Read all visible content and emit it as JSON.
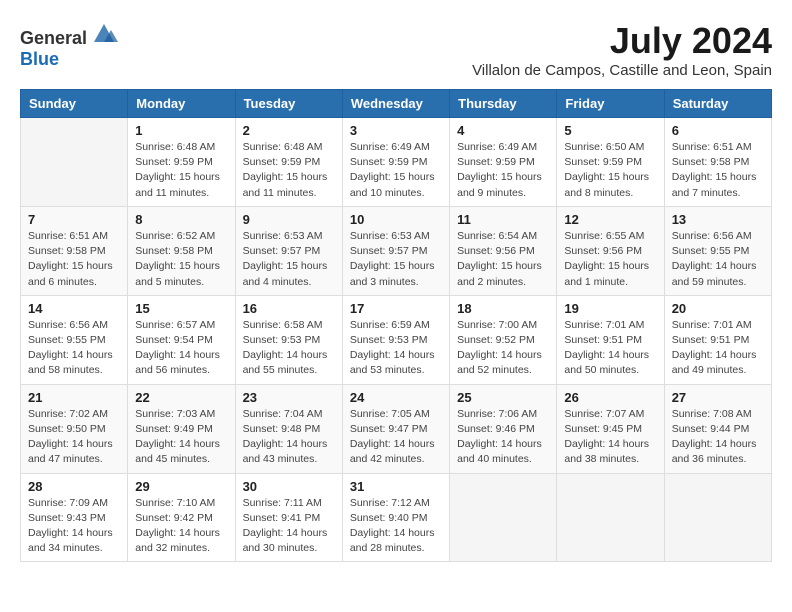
{
  "header": {
    "logo_general": "General",
    "logo_blue": "Blue",
    "month_year": "July 2024",
    "location": "Villalon de Campos, Castille and Leon, Spain"
  },
  "weekdays": [
    "Sunday",
    "Monday",
    "Tuesday",
    "Wednesday",
    "Thursday",
    "Friday",
    "Saturday"
  ],
  "weeks": [
    [
      {
        "day": "",
        "sunrise": "",
        "sunset": "",
        "daylight": ""
      },
      {
        "day": "1",
        "sunrise": "Sunrise: 6:48 AM",
        "sunset": "Sunset: 9:59 PM",
        "daylight": "Daylight: 15 hours and 11 minutes."
      },
      {
        "day": "2",
        "sunrise": "Sunrise: 6:48 AM",
        "sunset": "Sunset: 9:59 PM",
        "daylight": "Daylight: 15 hours and 11 minutes."
      },
      {
        "day": "3",
        "sunrise": "Sunrise: 6:49 AM",
        "sunset": "Sunset: 9:59 PM",
        "daylight": "Daylight: 15 hours and 10 minutes."
      },
      {
        "day": "4",
        "sunrise": "Sunrise: 6:49 AM",
        "sunset": "Sunset: 9:59 PM",
        "daylight": "Daylight: 15 hours and 9 minutes."
      },
      {
        "day": "5",
        "sunrise": "Sunrise: 6:50 AM",
        "sunset": "Sunset: 9:59 PM",
        "daylight": "Daylight: 15 hours and 8 minutes."
      },
      {
        "day": "6",
        "sunrise": "Sunrise: 6:51 AM",
        "sunset": "Sunset: 9:58 PM",
        "daylight": "Daylight: 15 hours and 7 minutes."
      }
    ],
    [
      {
        "day": "7",
        "sunrise": "Sunrise: 6:51 AM",
        "sunset": "Sunset: 9:58 PM",
        "daylight": "Daylight: 15 hours and 6 minutes."
      },
      {
        "day": "8",
        "sunrise": "Sunrise: 6:52 AM",
        "sunset": "Sunset: 9:58 PM",
        "daylight": "Daylight: 15 hours and 5 minutes."
      },
      {
        "day": "9",
        "sunrise": "Sunrise: 6:53 AM",
        "sunset": "Sunset: 9:57 PM",
        "daylight": "Daylight: 15 hours and 4 minutes."
      },
      {
        "day": "10",
        "sunrise": "Sunrise: 6:53 AM",
        "sunset": "Sunset: 9:57 PM",
        "daylight": "Daylight: 15 hours and 3 minutes."
      },
      {
        "day": "11",
        "sunrise": "Sunrise: 6:54 AM",
        "sunset": "Sunset: 9:56 PM",
        "daylight": "Daylight: 15 hours and 2 minutes."
      },
      {
        "day": "12",
        "sunrise": "Sunrise: 6:55 AM",
        "sunset": "Sunset: 9:56 PM",
        "daylight": "Daylight: 15 hours and 1 minute."
      },
      {
        "day": "13",
        "sunrise": "Sunrise: 6:56 AM",
        "sunset": "Sunset: 9:55 PM",
        "daylight": "Daylight: 14 hours and 59 minutes."
      }
    ],
    [
      {
        "day": "14",
        "sunrise": "Sunrise: 6:56 AM",
        "sunset": "Sunset: 9:55 PM",
        "daylight": "Daylight: 14 hours and 58 minutes."
      },
      {
        "day": "15",
        "sunrise": "Sunrise: 6:57 AM",
        "sunset": "Sunset: 9:54 PM",
        "daylight": "Daylight: 14 hours and 56 minutes."
      },
      {
        "day": "16",
        "sunrise": "Sunrise: 6:58 AM",
        "sunset": "Sunset: 9:53 PM",
        "daylight": "Daylight: 14 hours and 55 minutes."
      },
      {
        "day": "17",
        "sunrise": "Sunrise: 6:59 AM",
        "sunset": "Sunset: 9:53 PM",
        "daylight": "Daylight: 14 hours and 53 minutes."
      },
      {
        "day": "18",
        "sunrise": "Sunrise: 7:00 AM",
        "sunset": "Sunset: 9:52 PM",
        "daylight": "Daylight: 14 hours and 52 minutes."
      },
      {
        "day": "19",
        "sunrise": "Sunrise: 7:01 AM",
        "sunset": "Sunset: 9:51 PM",
        "daylight": "Daylight: 14 hours and 50 minutes."
      },
      {
        "day": "20",
        "sunrise": "Sunrise: 7:01 AM",
        "sunset": "Sunset: 9:51 PM",
        "daylight": "Daylight: 14 hours and 49 minutes."
      }
    ],
    [
      {
        "day": "21",
        "sunrise": "Sunrise: 7:02 AM",
        "sunset": "Sunset: 9:50 PM",
        "daylight": "Daylight: 14 hours and 47 minutes."
      },
      {
        "day": "22",
        "sunrise": "Sunrise: 7:03 AM",
        "sunset": "Sunset: 9:49 PM",
        "daylight": "Daylight: 14 hours and 45 minutes."
      },
      {
        "day": "23",
        "sunrise": "Sunrise: 7:04 AM",
        "sunset": "Sunset: 9:48 PM",
        "daylight": "Daylight: 14 hours and 43 minutes."
      },
      {
        "day": "24",
        "sunrise": "Sunrise: 7:05 AM",
        "sunset": "Sunset: 9:47 PM",
        "daylight": "Daylight: 14 hours and 42 minutes."
      },
      {
        "day": "25",
        "sunrise": "Sunrise: 7:06 AM",
        "sunset": "Sunset: 9:46 PM",
        "daylight": "Daylight: 14 hours and 40 minutes."
      },
      {
        "day": "26",
        "sunrise": "Sunrise: 7:07 AM",
        "sunset": "Sunset: 9:45 PM",
        "daylight": "Daylight: 14 hours and 38 minutes."
      },
      {
        "day": "27",
        "sunrise": "Sunrise: 7:08 AM",
        "sunset": "Sunset: 9:44 PM",
        "daylight": "Daylight: 14 hours and 36 minutes."
      }
    ],
    [
      {
        "day": "28",
        "sunrise": "Sunrise: 7:09 AM",
        "sunset": "Sunset: 9:43 PM",
        "daylight": "Daylight: 14 hours and 34 minutes."
      },
      {
        "day": "29",
        "sunrise": "Sunrise: 7:10 AM",
        "sunset": "Sunset: 9:42 PM",
        "daylight": "Daylight: 14 hours and 32 minutes."
      },
      {
        "day": "30",
        "sunrise": "Sunrise: 7:11 AM",
        "sunset": "Sunset: 9:41 PM",
        "daylight": "Daylight: 14 hours and 30 minutes."
      },
      {
        "day": "31",
        "sunrise": "Sunrise: 7:12 AM",
        "sunset": "Sunset: 9:40 PM",
        "daylight": "Daylight: 14 hours and 28 minutes."
      },
      {
        "day": "",
        "sunrise": "",
        "sunset": "",
        "daylight": ""
      },
      {
        "day": "",
        "sunrise": "",
        "sunset": "",
        "daylight": ""
      },
      {
        "day": "",
        "sunrise": "",
        "sunset": "",
        "daylight": ""
      }
    ]
  ]
}
